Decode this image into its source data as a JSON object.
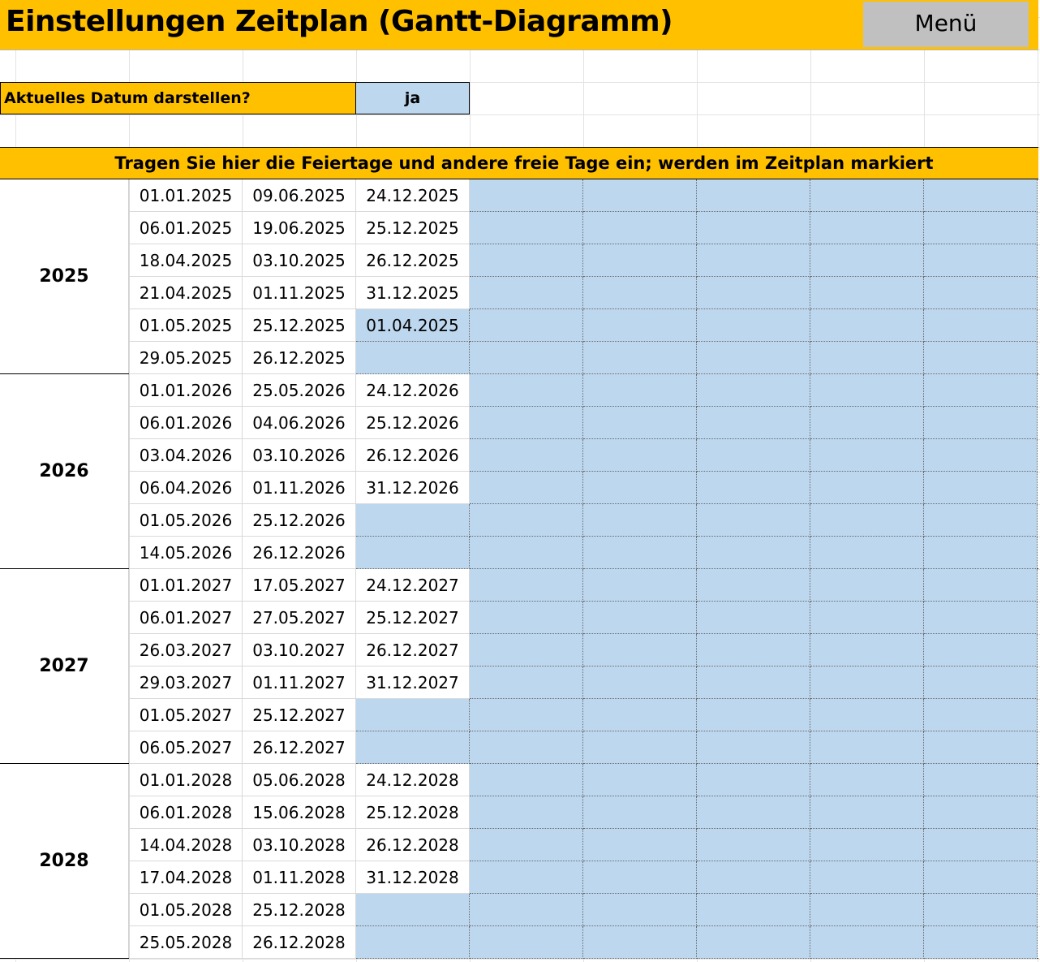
{
  "sheet": {
    "title": "Einstellungen Zeitplan (Gantt-Diagramm)",
    "menu_button": "Menü",
    "option": {
      "label": "Aktuelles Datum darstellen?",
      "value": "ja"
    },
    "holidays_header": "Tragen Sie hier die Feiertage und andere freie Tage ein; werden im Zeitplan markiert"
  },
  "colors": {
    "header_yellow": "#ffc000",
    "input_blue": "#bdd7ee",
    "menu_gray": "#c0c0c0"
  },
  "years": [
    {
      "year": "2025",
      "columns": [
        [
          "01.01.2025",
          "06.01.2025",
          "18.04.2025",
          "21.04.2025",
          "01.05.2025",
          "29.05.2025"
        ],
        [
          "09.06.2025",
          "19.06.2025",
          "03.10.2025",
          "01.11.2025",
          "25.12.2025",
          "26.12.2025"
        ],
        [
          "24.12.2025",
          "25.12.2025",
          "26.12.2025",
          "31.12.2025",
          "01.04.2025",
          ""
        ]
      ]
    },
    {
      "year": "2026",
      "columns": [
        [
          "01.01.2026",
          "06.01.2026",
          "03.04.2026",
          "06.04.2026",
          "01.05.2026",
          "14.05.2026"
        ],
        [
          "25.05.2026",
          "04.06.2026",
          "03.10.2026",
          "01.11.2026",
          "25.12.2026",
          "26.12.2026"
        ],
        [
          "24.12.2026",
          "25.12.2026",
          "26.12.2026",
          "31.12.2026",
          "",
          ""
        ]
      ]
    },
    {
      "year": "2027",
      "columns": [
        [
          "01.01.2027",
          "06.01.2027",
          "26.03.2027",
          "29.03.2027",
          "01.05.2027",
          "06.05.2027"
        ],
        [
          "17.05.2027",
          "27.05.2027",
          "03.10.2027",
          "01.11.2027",
          "25.12.2027",
          "26.12.2027"
        ],
        [
          "24.12.2027",
          "25.12.2027",
          "26.12.2027",
          "31.12.2027",
          "",
          ""
        ]
      ]
    },
    {
      "year": "2028",
      "columns": [
        [
          "01.01.2028",
          "06.01.2028",
          "14.04.2028",
          "17.04.2028",
          "01.05.2028",
          "25.05.2028"
        ],
        [
          "05.06.2028",
          "15.06.2028",
          "03.10.2028",
          "01.11.2028",
          "25.12.2028",
          "26.12.2028"
        ],
        [
          "24.12.2028",
          "25.12.2028",
          "26.12.2028",
          "31.12.2028",
          "",
          ""
        ]
      ]
    }
  ]
}
